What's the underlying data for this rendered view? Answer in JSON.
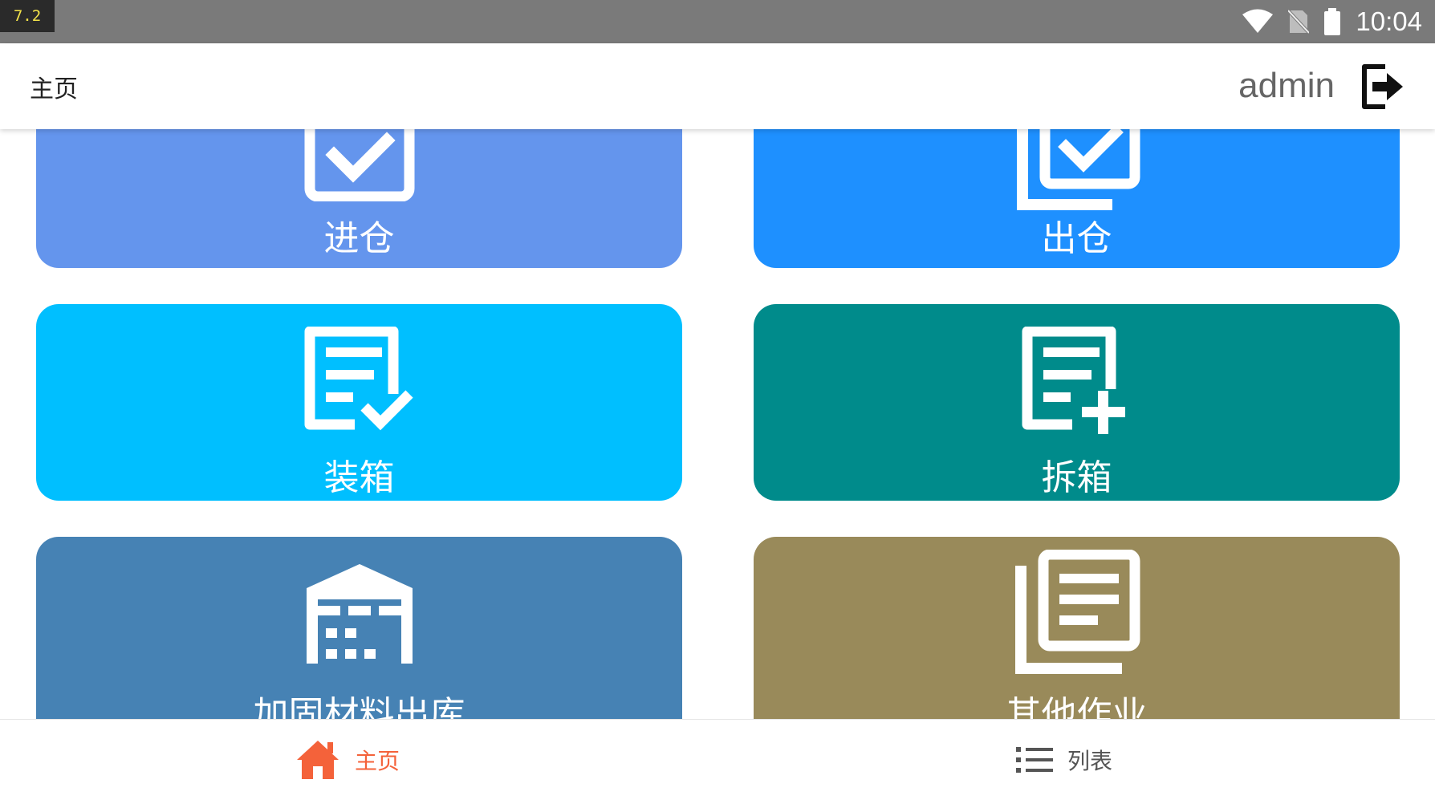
{
  "status_bar": {
    "version": "7.2",
    "time": "10:04",
    "icons": [
      "wifi-icon",
      "no-sim-icon",
      "battery-icon"
    ]
  },
  "app_bar": {
    "title": "主页",
    "username": "admin",
    "logout_icon": "logout-icon"
  },
  "tiles": [
    {
      "label": "进仓",
      "icon": "checkbox-icon",
      "color": "#6495ED"
    },
    {
      "label": "出仓",
      "icon": "copy-check-icon",
      "color": "#1E90FF"
    },
    {
      "label": "装箱",
      "icon": "document-check-icon",
      "color": "#00BFFF"
    },
    {
      "label": "拆箱",
      "icon": "document-add-icon",
      "color": "#008B8B"
    },
    {
      "label": "加固材料出库",
      "icon": "warehouse-icon",
      "color": "#4682B4"
    },
    {
      "label": "其他作业",
      "icon": "documents-icon",
      "color": "#998A5A"
    }
  ],
  "bottom_nav": {
    "items": [
      {
        "label": "主页",
        "icon": "home-icon",
        "active": true
      },
      {
        "label": "列表",
        "icon": "list-icon",
        "active": false
      }
    ],
    "active_color": "#F4623A",
    "inactive_color": "#555555"
  }
}
